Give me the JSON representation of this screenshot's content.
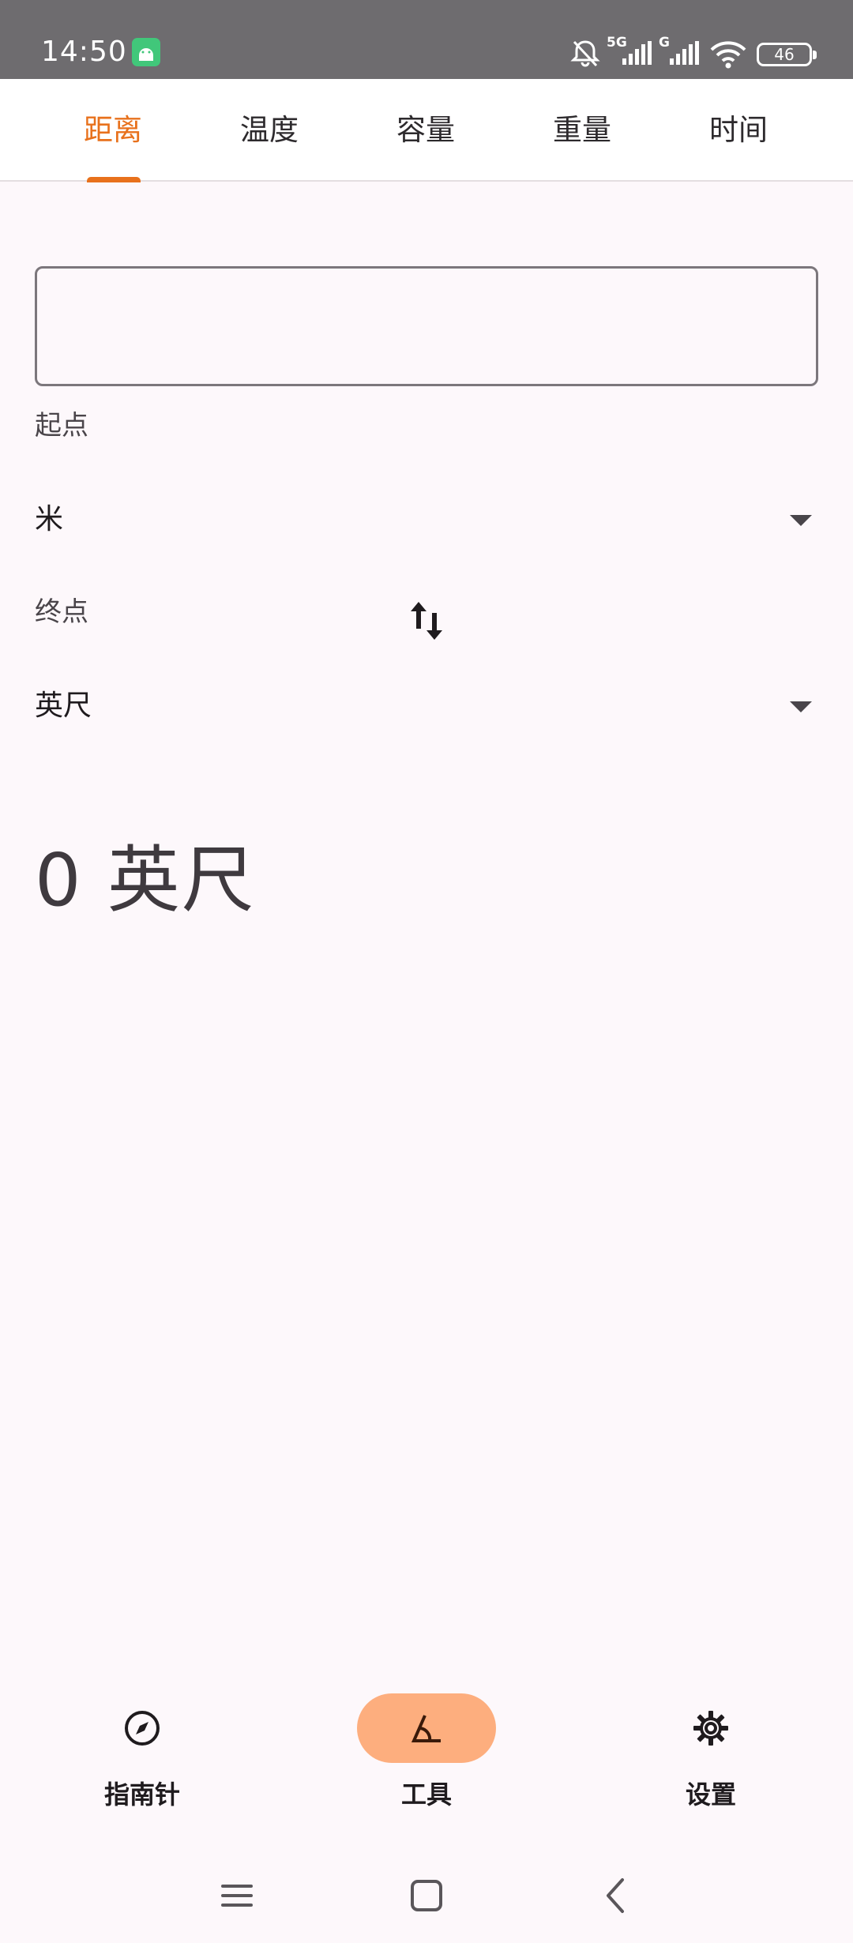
{
  "status_bar": {
    "time": "14:50",
    "network_1": "5G",
    "network_2": "G",
    "battery": "46"
  },
  "tabs": [
    {
      "label": "距离"
    },
    {
      "label": "温度"
    },
    {
      "label": "容量"
    },
    {
      "label": "重量"
    },
    {
      "label": "时间"
    }
  ],
  "converter": {
    "input_value": "",
    "from_label": "起点",
    "from_unit": "米",
    "to_label": "终点",
    "to_unit": "英尺",
    "result": "0 英尺"
  },
  "bottom_nav": {
    "items": [
      {
        "label": "指南针",
        "icon": "compass-icon"
      },
      {
        "label": "工具",
        "icon": "angle-tool-icon"
      },
      {
        "label": "设置",
        "icon": "gear-icon"
      }
    ],
    "active_index": 1
  },
  "colors": {
    "accent": "#e8711c",
    "active_pill": "#fdae7e",
    "background": "#fdf8fb",
    "status_bar": "#6e6c6f"
  }
}
